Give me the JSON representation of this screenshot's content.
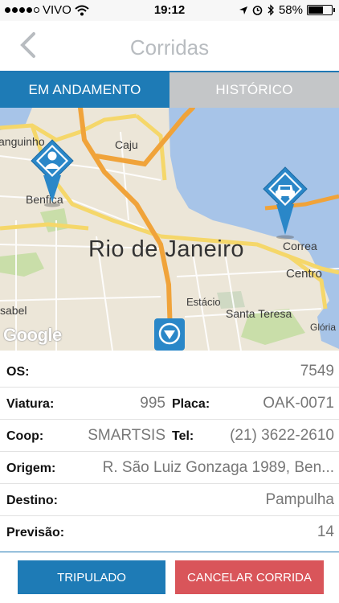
{
  "status_bar": {
    "carrier": "VIVO",
    "time": "19:12",
    "battery": "58%"
  },
  "nav": {
    "title": "Corridas"
  },
  "tabs": [
    {
      "label": "EM ANDAMENTO",
      "active": true
    },
    {
      "label": "HISTÓRICO",
      "active": false
    }
  ],
  "map": {
    "labels": {
      "anguinho": "anguinho",
      "caju": "Caju",
      "benfica": "Benfica",
      "rio": "Rio de Janeiro",
      "correa": "Correa",
      "centro": "Centro",
      "isabel": "sabel",
      "estacio": "Estácio",
      "santa_teresa": "Santa Teresa",
      "gloria": "Glória",
      "google": "Google"
    },
    "pins": [
      {
        "name": "person",
        "icon": "person-icon"
      },
      {
        "name": "taxi",
        "icon": "taxi-icon"
      },
      {
        "name": "location",
        "icon": "chevron-down-icon"
      }
    ]
  },
  "details": {
    "os_label": "OS:",
    "os_value": "7549",
    "viatura_label": "Viatura:",
    "viatura_value": "995",
    "placa_label": "Placa:",
    "placa_value": "OAK-0071",
    "coop_label": "Coop:",
    "coop_value": "SMARTSIS",
    "tel_label": "Tel:",
    "tel_value": "(21) 3622-2610",
    "origem_label": "Origem:",
    "origem_value": "R. São Luiz Gonzaga 1989, Ben...",
    "destino_label": "Destino:",
    "destino_value": "Pampulha",
    "previsao_label": "Previsão:",
    "previsao_value": "14"
  },
  "buttons": {
    "tripulado": "TRIPULADO",
    "cancelar": "CANCELAR CORRIDA"
  },
  "colors": {
    "accent": "#1e7bb6",
    "cancel": "#d9555a",
    "tab_inactive": "#c4c6c8"
  }
}
